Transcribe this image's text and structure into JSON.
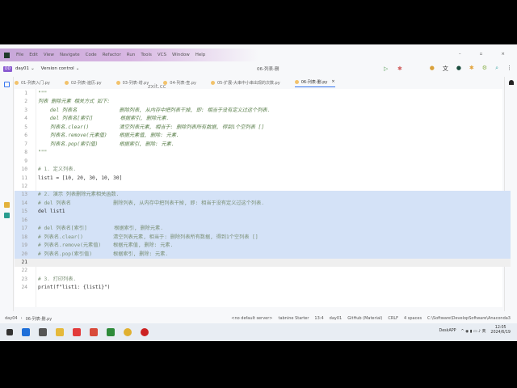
{
  "menu": [
    "File",
    "Edit",
    "View",
    "Navigate",
    "Code",
    "Refactor",
    "Run",
    "Tools",
    "VCS",
    "Window",
    "Help"
  ],
  "toolbar": {
    "project": "day01",
    "project_badge": "DD",
    "vcs": "Version control",
    "run_config": "06-列表-删"
  },
  "tabs": [
    "01-列表入门.py",
    "02-列表-遍历.py",
    "03-列表-增.py",
    "04-列表-查.py",
    "05-扩展-大串中小串出现的次数.py",
    "06-列表-删.py"
  ],
  "code": {
    "lines": [
      "\"\"\"",
      "列表 删除元素 相关方式 如下:",
      "    del 列表名              删除列表, 从内存中把列表干掉, 即: 相当于没有定义过这个列表.",
      "    del 列表名[索引]         根据索引, 删除元素.",
      "    列表名.clear()          清空列表元素, 相当于: 删除列表所有数据, 得到1个空列表 []",
      "    列表名.remove(元素值)    根据元素值, 删除: 元素.",
      "    列表名.pop(索引值)       根据索引, 删除: 元素.",
      "\"\"\"",
      "",
      "# 1. 定义列表.",
      "list1 = [10, 20, 30, 10, 30]",
      "",
      "# 2. 演示 列表删除元素相关函数.",
      "# del 列表名              删除列表, 从内存中把列表干掉, 即: 相当于没有定义过这个列表.",
      "del list1",
      "",
      "# del 列表名[索引]         根据索引, 删除元素.",
      "# 列表名.clear()          清空列表元素, 相当于: 删除列表所有数据, 得到1个空列表 []",
      "# 列表名.remove(元素值)    根据元素值, 删除: 元素.",
      "# 列表名.pop(索引值)       根据索引, 删除: 元素.",
      "",
      "",
      "# 3. 打印列表.",
      "print(f\"list1: {list1}\")"
    ]
  },
  "breadcrumb": [
    "day04",
    "06-列表-删.py"
  ],
  "status": [
    "<no default server>",
    "tabnine Starter",
    "13:4",
    "day01",
    "GitHub (Material)",
    "CRLF",
    "4 spaces",
    "C:\\Software\\DevelopSoftware\\Anaconda3"
  ],
  "taskbar": {
    "app": "DeskAPP",
    "time": "12:05",
    "date": "2024/6/19"
  },
  "watermark": "zxit.cc"
}
